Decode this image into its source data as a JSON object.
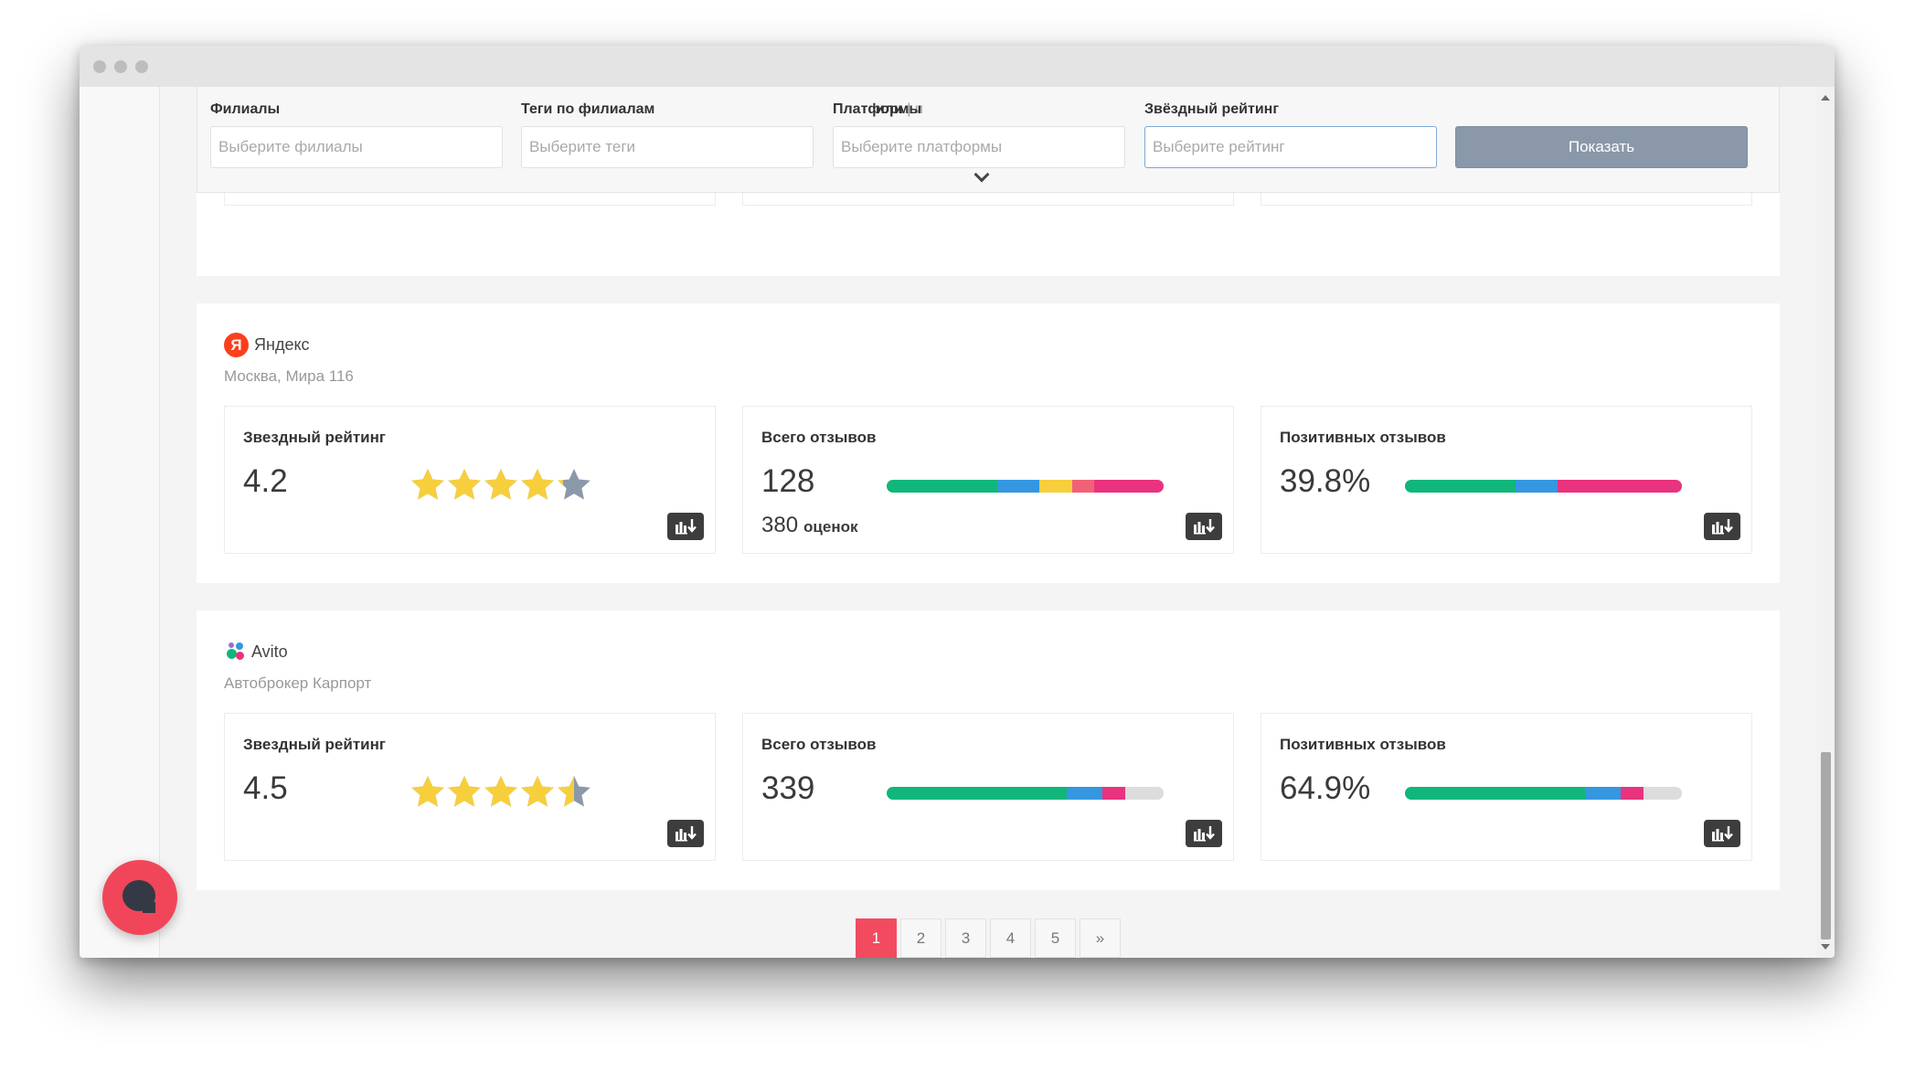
{
  "filters": {
    "branches": {
      "label": "Филиалы",
      "placeholder": "Выберите филиалы"
    },
    "tags": {
      "label": "Теги по филиалам",
      "placeholder": "Выберите теги",
      "or_label": "или",
      "and_label": "и",
      "separator": "|"
    },
    "platforms": {
      "label": "Платформы",
      "placeholder": "Выберите платформы"
    },
    "rating": {
      "label": "Звёздный рейтинг",
      "placeholder": "Выберите рейтинг"
    },
    "show_button": "Показать"
  },
  "cards": [
    {
      "platform": "Яндекс",
      "logo_letter": "Я",
      "branch": "Москва, Мира 116",
      "rating": {
        "title": "Звездный рейтинг",
        "value": "4.2",
        "stars_fraction": 0.84
      },
      "reviews": {
        "title": "Всего отзывов",
        "value": "128",
        "ratings_count": "380",
        "ratings_label": "оценок",
        "segments": [
          {
            "color": "#10b67a",
            "share": 0.4
          },
          {
            "color": "#3497e0",
            "share": 0.15
          },
          {
            "color": "#f7cf3c",
            "share": 0.12
          },
          {
            "color": "#f06277",
            "share": 0.08
          },
          {
            "color": "#e9337f",
            "share": 0.25
          }
        ]
      },
      "positive": {
        "title": "Позитивных отзывов",
        "value": "39.8%",
        "segments": [
          {
            "color": "#10b67a",
            "share": 0.4
          },
          {
            "color": "#3497e0",
            "share": 0.15
          },
          {
            "color": "#e9337f",
            "share": 0.45
          }
        ]
      }
    },
    {
      "platform": "Avito",
      "branch": "Автоброкер Карпорт",
      "rating": {
        "title": "Звездный рейтинг",
        "value": "4.5",
        "stars_fraction": 0.9
      },
      "reviews": {
        "title": "Всего отзывов",
        "value": "339",
        "segments": [
          {
            "color": "#10b67a",
            "share": 0.65
          },
          {
            "color": "#3497e0",
            "share": 0.13
          },
          {
            "color": "#e9337f",
            "share": 0.08
          },
          {
            "color": "#dcdcdc",
            "share": 0.14
          }
        ]
      },
      "positive": {
        "title": "Позитивных отзывов",
        "value": "64.9%",
        "segments": [
          {
            "color": "#10b67a",
            "share": 0.65
          },
          {
            "color": "#3497e0",
            "share": 0.13
          },
          {
            "color": "#e9337f",
            "share": 0.08
          },
          {
            "color": "#dcdcdc",
            "share": 0.14
          }
        ]
      }
    }
  ],
  "pagination": {
    "pages": [
      "1",
      "2",
      "3",
      "4",
      "5"
    ],
    "next": "»",
    "current": "1"
  },
  "colors": {
    "accent": "#f24b5f",
    "star": "#f7cf3c",
    "star_empty": "#8a98aa"
  },
  "icons": {
    "export": "export-chart-icon",
    "chat": "chat-bubble-icon",
    "dropdown": "chevron-down-icon"
  }
}
